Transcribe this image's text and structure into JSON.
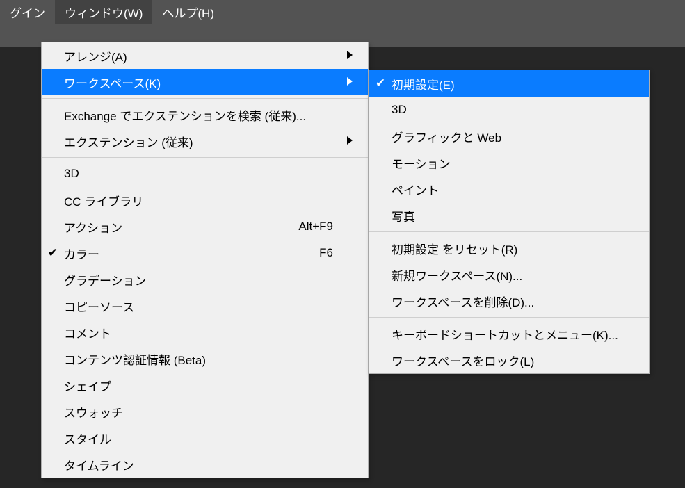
{
  "menubar": {
    "items": [
      {
        "label": "グイン"
      },
      {
        "label": "ウィンドウ(W)"
      },
      {
        "label": "ヘルプ(H)"
      }
    ],
    "activeIndex": 1
  },
  "windowMenu": {
    "groups": [
      [
        {
          "label": "アレンジ(A)",
          "submenu": true
        },
        {
          "label": "ワークスペース(K)",
          "submenu": true,
          "highlight": true
        }
      ],
      [
        {
          "label": "Exchange でエクステンションを検索 (従来)..."
        },
        {
          "label": "エクステンション (従来)",
          "submenu": true
        }
      ],
      [
        {
          "label": "3D"
        },
        {
          "label": "CC ライブラリ"
        },
        {
          "label": "アクション",
          "shortcut": "Alt+F9"
        },
        {
          "label": "カラー",
          "shortcut": "F6",
          "checked": true
        },
        {
          "label": "グラデーション"
        },
        {
          "label": "コピーソース"
        },
        {
          "label": "コメント"
        },
        {
          "label": "コンテンツ認証情報 (Beta)"
        },
        {
          "label": "シェイプ"
        },
        {
          "label": "スウォッチ"
        },
        {
          "label": "スタイル"
        },
        {
          "label": "タイムライン"
        }
      ]
    ]
  },
  "workspaceMenu": {
    "groups": [
      [
        {
          "label": "初期設定(E)",
          "checked": true,
          "highlight": true
        },
        {
          "label": "3D"
        },
        {
          "label": "グラフィックと Web"
        },
        {
          "label": "モーション"
        },
        {
          "label": "ペイント"
        },
        {
          "label": "写真"
        }
      ],
      [
        {
          "label": "初期設定 をリセット(R)"
        },
        {
          "label": "新規ワークスペース(N)..."
        },
        {
          "label": "ワークスペースを削除(D)..."
        }
      ],
      [
        {
          "label": "キーボードショートカットとメニュー(K)..."
        },
        {
          "label": "ワークスペースをロック(L)"
        }
      ]
    ]
  }
}
